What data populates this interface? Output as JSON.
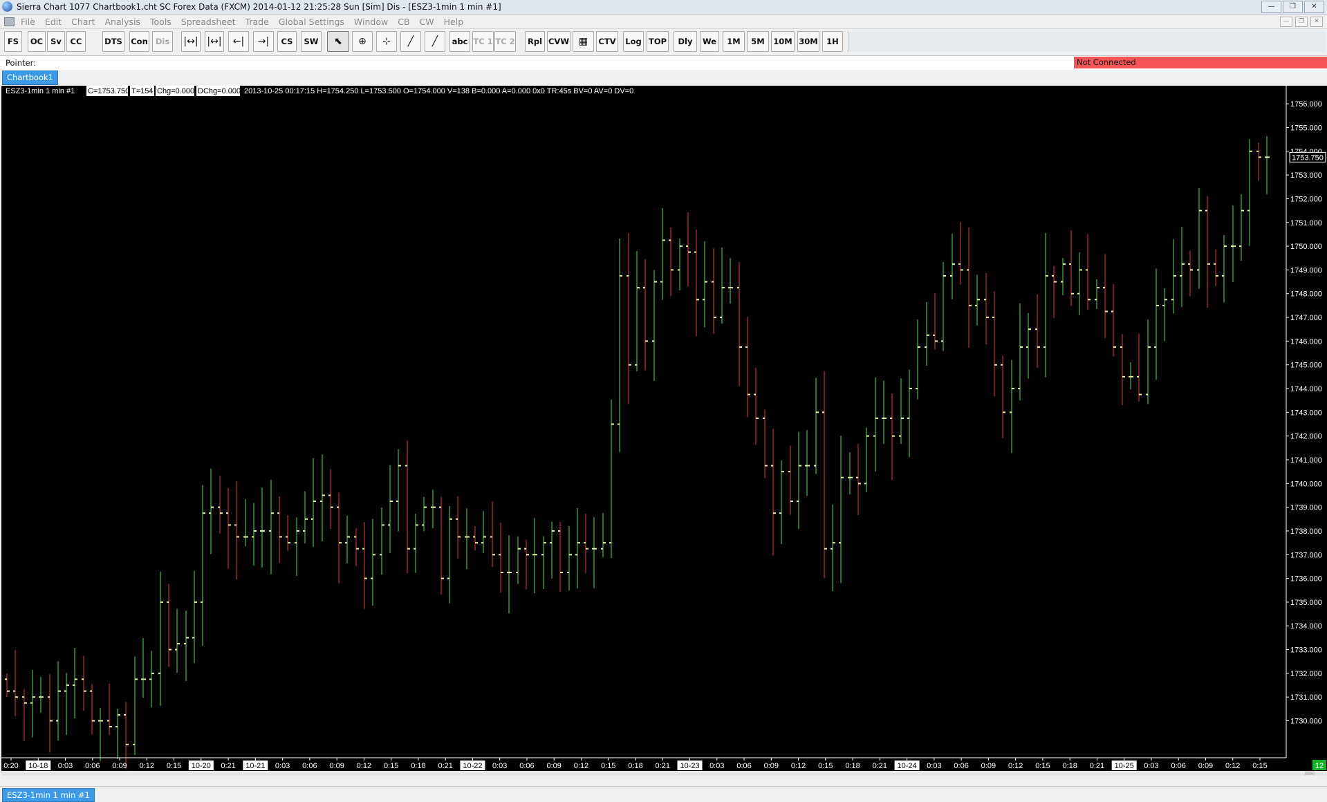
{
  "window": {
    "title": "Sierra Chart 1077 Chartbook1.cht  SC Forex Data (FXCM) 2014-01-12  21:25:28 Sun [Sim]  Dis - [ESZ3-1min  1 min  #1]",
    "buttons": [
      "minimize",
      "restore",
      "close"
    ]
  },
  "menu": [
    "File",
    "Edit",
    "Chart",
    "Analysis",
    "Tools",
    "Spreadsheet",
    "Trade",
    "Global Settings",
    "Window",
    "CB",
    "CW",
    "Help"
  ],
  "toolbar": {
    "buttons": [
      {
        "label": "FS",
        "disabled": false
      },
      {
        "label": "OC",
        "disabled": false
      },
      {
        "label": "Sv",
        "disabled": false
      },
      {
        "label": "CC",
        "disabled": false
      },
      {
        "label": "DTS",
        "disabled": false
      },
      {
        "label": "Con",
        "disabled": false
      },
      {
        "label": "Dis",
        "disabled": true
      },
      {
        "label": "",
        "icon": "zoom-range-icon"
      },
      {
        "label": "",
        "icon": "zoom-in-range-icon"
      },
      {
        "label": "",
        "icon": "scale-in-icon"
      },
      {
        "label": "",
        "icon": "scale-out-icon"
      },
      {
        "label": "CS",
        "disabled": false
      },
      {
        "label": "SW",
        "disabled": false
      },
      {
        "label": "",
        "icon": "pointer-icon"
      },
      {
        "label": "",
        "icon": "crosshair-icon"
      },
      {
        "label": "",
        "icon": "values-crosshair-icon"
      },
      {
        "label": "",
        "icon": "line-tool-icon"
      },
      {
        "label": "",
        "icon": "ray-tool-icon"
      },
      {
        "label": "abc",
        "disabled": false
      },
      {
        "label": "TC 1",
        "disabled": true
      },
      {
        "label": "TC 2",
        "disabled": true
      },
      {
        "label": "Rpl",
        "disabled": false
      },
      {
        "label": "CVW",
        "disabled": false
      },
      {
        "label": "",
        "icon": "calendar-grid-icon"
      },
      {
        "label": "CTV",
        "disabled": false
      },
      {
        "label": "Log",
        "disabled": false
      },
      {
        "label": "TOP",
        "disabled": false
      },
      {
        "label": "Dly",
        "disabled": false
      },
      {
        "label": "We",
        "disabled": false
      },
      {
        "label": "1M",
        "disabled": false
      },
      {
        "label": "5M",
        "disabled": false
      },
      {
        "label": "10M",
        "disabled": false
      },
      {
        "label": "30M",
        "disabled": false
      },
      {
        "label": "1H",
        "disabled": false
      }
    ]
  },
  "status": {
    "pointer_label": "Pointer:",
    "connection": "Not Connected"
  },
  "chartbook_tab": "Chartbook1",
  "chart_header": {
    "symbol": "ESZ3-1min  1 min   #1",
    "close": "C=1753.750",
    "ticks": "T=154",
    "change": "Chg=0.000",
    "daily_change": "DChg=0.000",
    "bar_info": "2013-10-25 00:17:15 H=1754.250 L=1753.500 O=1754.000 V=138 B=0.000 A=0.000 0x0 TR:45s BV=0 AV=0 DV=0"
  },
  "chart_data": {
    "type": "ohlc",
    "y_axis": {
      "min": 1728.5,
      "max": 1756.5,
      "step": 1.0,
      "decimals": 3
    },
    "last_price": "1753.750",
    "x_labels": [
      {
        "text": "0:20",
        "date": false
      },
      {
        "text": "10-18",
        "date": true
      },
      {
        "text": "0:03",
        "date": false
      },
      {
        "text": "0:06",
        "date": false
      },
      {
        "text": "0:09",
        "date": false
      },
      {
        "text": "0:12",
        "date": false
      },
      {
        "text": "0:15",
        "date": false
      },
      {
        "text": "10-20",
        "date": true
      },
      {
        "text": "0:21",
        "date": false
      },
      {
        "text": "10-21",
        "date": true
      },
      {
        "text": "0:03",
        "date": false
      },
      {
        "text": "0:06",
        "date": false
      },
      {
        "text": "0:09",
        "date": false
      },
      {
        "text": "0:12",
        "date": false
      },
      {
        "text": "0:15",
        "date": false
      },
      {
        "text": "0:18",
        "date": false
      },
      {
        "text": "0:21",
        "date": false
      },
      {
        "text": "10-22",
        "date": true
      },
      {
        "text": "0:03",
        "date": false
      },
      {
        "text": "0:06",
        "date": false
      },
      {
        "text": "0:09",
        "date": false
      },
      {
        "text": "0:12",
        "date": false
      },
      {
        "text": "0:15",
        "date": false
      },
      {
        "text": "0:18",
        "date": false
      },
      {
        "text": "0:21",
        "date": false
      },
      {
        "text": "10-23",
        "date": true
      },
      {
        "text": "0:03",
        "date": false
      },
      {
        "text": "0:06",
        "date": false
      },
      {
        "text": "0:09",
        "date": false
      },
      {
        "text": "0:12",
        "date": false
      },
      {
        "text": "0:15",
        "date": false
      },
      {
        "text": "0:18",
        "date": false
      },
      {
        "text": "0:21",
        "date": false
      },
      {
        "text": "10-24",
        "date": true
      },
      {
        "text": "0:03",
        "date": false
      },
      {
        "text": "0:06",
        "date": false
      },
      {
        "text": "0:09",
        "date": false
      },
      {
        "text": "0:12",
        "date": false
      },
      {
        "text": "0:15",
        "date": false
      },
      {
        "text": "0:18",
        "date": false
      },
      {
        "text": "0:21",
        "date": false
      },
      {
        "text": "10-25",
        "date": true
      },
      {
        "text": "0:03",
        "date": false
      },
      {
        "text": "0:06",
        "date": false
      },
      {
        "text": "0:09",
        "date": false
      },
      {
        "text": "0:12",
        "date": false
      },
      {
        "text": "0:15",
        "date": false
      }
    ],
    "bars_close": [
      1731.25,
      1731.0,
      1730.75,
      1731.0,
      1731.0,
      1730.0,
      1731.25,
      1731.5,
      1731.75,
      1731.25,
      1730.0,
      1730.0,
      1729.75,
      1730.25,
      1729.0,
      1731.75,
      1731.75,
      1732.0,
      1735.0,
      1733.0,
      1733.25,
      1733.5,
      1735.0,
      1738.75,
      1739.0,
      1738.75,
      1738.25,
      1737.75,
      1737.75,
      1738.0,
      1738.0,
      1738.75,
      1737.75,
      1737.5,
      1738.0,
      1738.5,
      1739.25,
      1739.5,
      1739.0,
      1737.5,
      1737.75,
      1737.25,
      1736.0,
      1737.0,
      1738.25,
      1739.25,
      1740.75,
      1737.25,
      1738.25,
      1739.0,
      1739.0,
      1736.0,
      1738.5,
      1737.75,
      1737.75,
      1737.5,
      1737.75,
      1737.0,
      1736.25,
      1736.25,
      1737.25,
      1737.0,
      1737.0,
      1737.5,
      1738.0,
      1736.25,
      1737.0,
      1737.5,
      1737.25,
      1737.25,
      1737.5,
      1742.5,
      1748.75,
      1745.0,
      1748.25,
      1746.0,
      1748.5,
      1750.25,
      1749.0,
      1750.0,
      1749.75,
      1747.75,
      1748.5,
      1747.0,
      1748.25,
      1748.25,
      1745.75,
      1743.75,
      1742.75,
      1740.75,
      1738.75,
      1740.5,
      1739.25,
      1740.75,
      1740.75,
      1743.0,
      1737.25,
      1737.5,
      1740.25,
      1740.25,
      1740.0,
      1742.0,
      1742.75,
      1742.75,
      1742.0,
      1742.75,
      1744.0,
      1745.75,
      1746.25,
      1746.0,
      1748.75,
      1749.25,
      1749.0,
      1747.5,
      1747.75,
      1747.0,
      1745.0,
      1743.0,
      1744.0,
      1745.75,
      1746.5,
      1745.75,
      1748.75,
      1748.5,
      1749.25,
      1748.0,
      1749.0,
      1747.75,
      1748.25,
      1747.25,
      1745.75,
      1744.5,
      1744.5,
      1743.75,
      1745.75,
      1747.5,
      1747.75,
      1748.75,
      1749.25,
      1749.0,
      1751.5,
      1749.25,
      1748.75,
      1750.0,
      1750.0,
      1751.5,
      1754.0,
      1753.75,
      1753.75
    ]
  }
}
